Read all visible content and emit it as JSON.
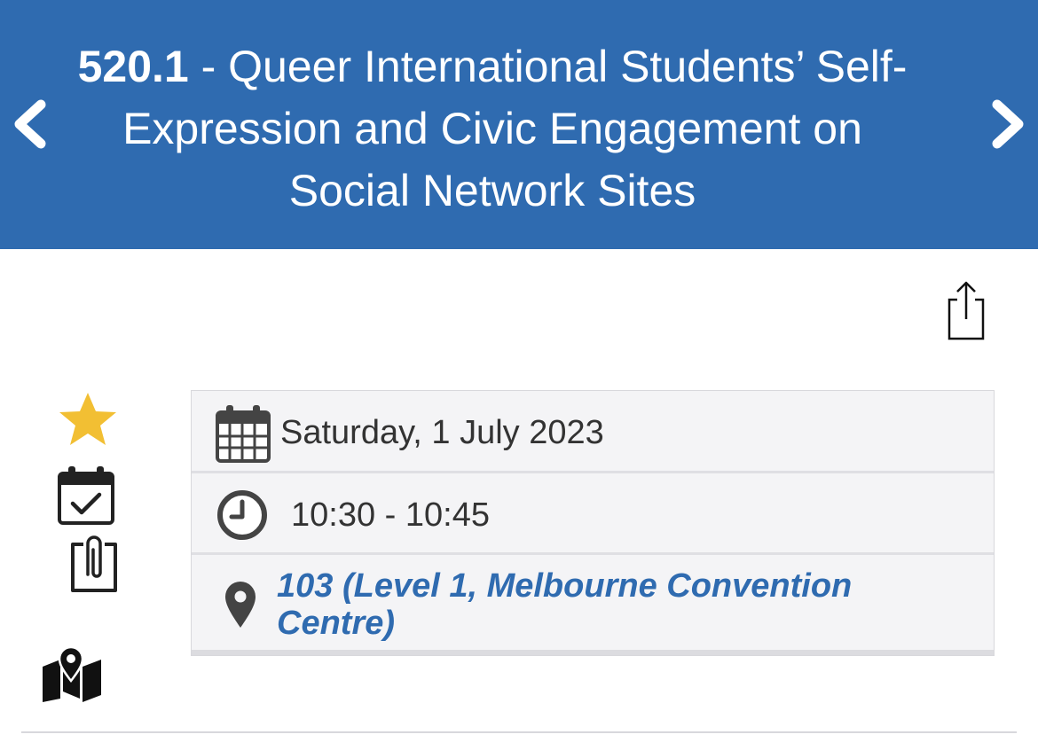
{
  "header": {
    "session_number": "520.1",
    "title_rest": " - Queer International Students’ Self-Expression and Civic Engagement on Social Network Sites",
    "background": "#2f6bb0",
    "prev_icon": "chevron-left-icon",
    "next_icon": "chevron-right-icon"
  },
  "actions": {
    "share_icon": "share-icon",
    "favorite_icon": "star-icon",
    "favorite_color": "#f2bf33",
    "add_calendar_icon": "calendar-check-icon",
    "attachment_icon": "paperclip-icon",
    "map_icon": "map-marker-icon"
  },
  "details": {
    "date": "Saturday, 1 July 2023",
    "time": "10:30 - 10:45",
    "location": "103 (Level 1, Melbourne Convention Centre)",
    "link_color": "#2f6bb0"
  }
}
